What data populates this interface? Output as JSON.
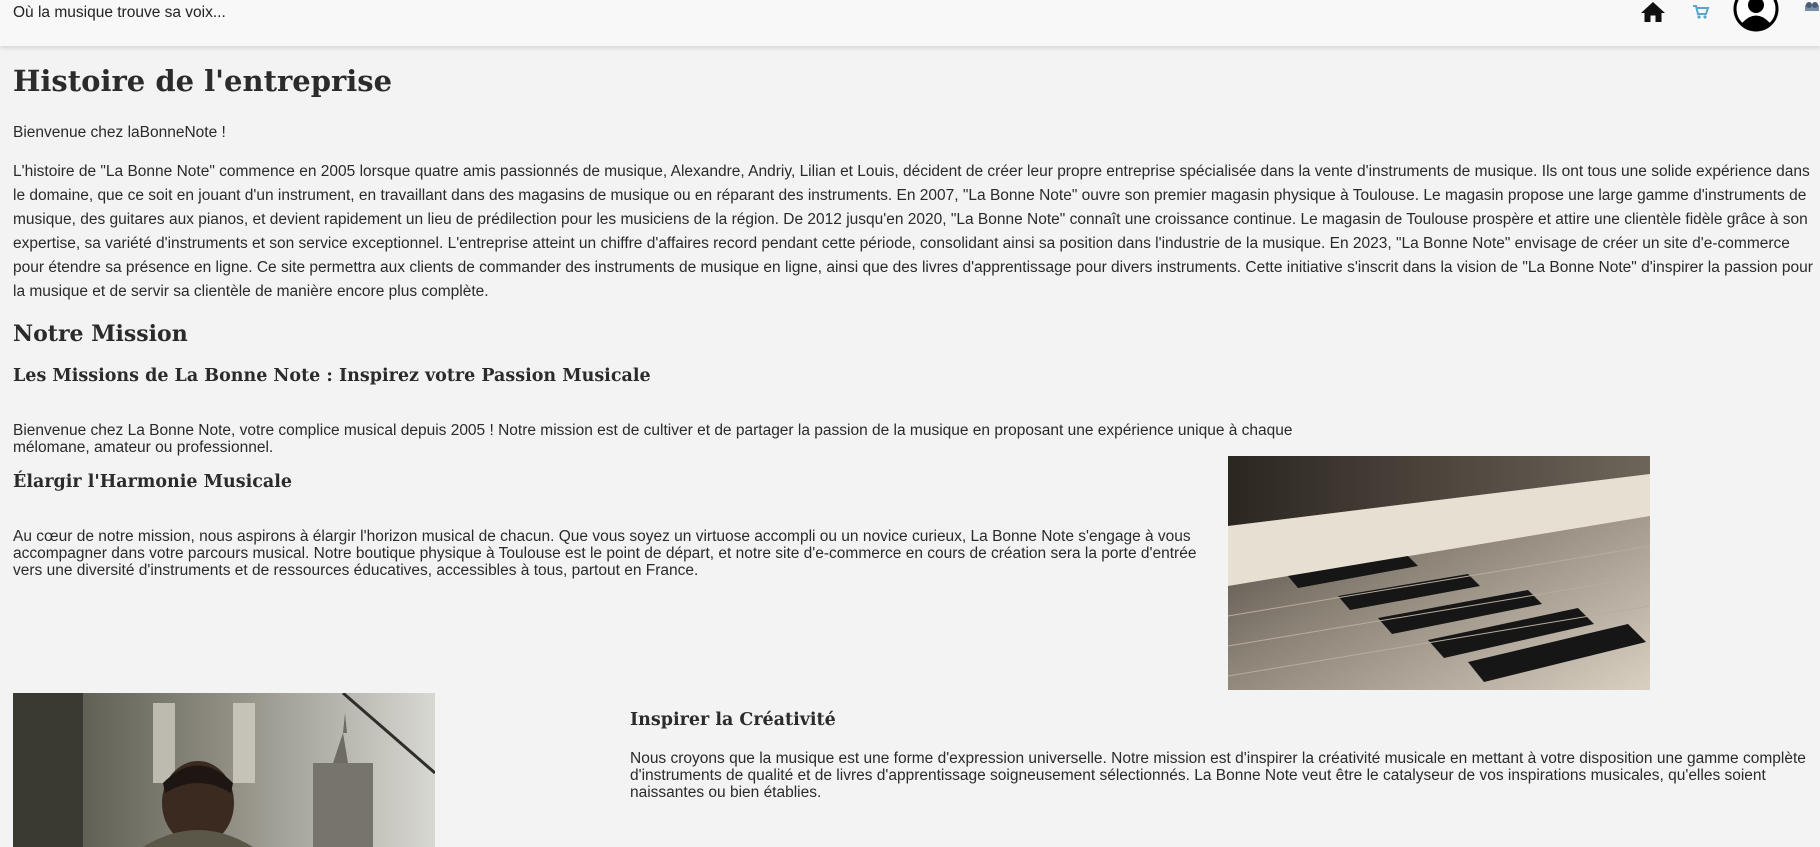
{
  "header": {
    "tagline": "Où la musique trouve sa voix...",
    "icons": [
      "home-icon",
      "cart-icon",
      "user-avatar-icon",
      "misc-icon"
    ],
    "accent_color": "#5aa6c8"
  },
  "history": {
    "title": "Histoire de l'entreprise",
    "welcome": "Bienvenue chez laBonneNote !",
    "body": "L'histoire de \"La Bonne Note\" commence en 2005 lorsque quatre amis passionnés de musique, Alexandre, Andriy, Lilian et Louis, décident de créer leur propre entreprise spécialisée dans la vente d'instruments de musique. Ils ont tous une solide expérience dans le domaine, que ce soit en jouant d'un instrument, en travaillant dans des magasins de musique ou en réparant des instruments. En 2007, \"La Bonne Note\" ouvre son premier magasin physique à Toulouse. Le magasin propose une large gamme d'instruments de musique, des guitares aux pianos, et devient rapidement un lieu de prédilection pour les musiciens de la région. De 2012 jusqu'en 2020, \"La Bonne Note\" connaît une croissance continue. Le magasin de Toulouse prospère et attire une clientèle fidèle grâce à son expertise, sa variété d'instruments et son service exceptionnel. L'entreprise atteint un chiffre d'affaires record pendant cette période, consolidant ainsi sa position dans l'industrie de la musique. En 2023, \"La Bonne Note\" envisage de créer un site d'e-commerce pour étendre sa présence en ligne. Ce site permettra aux clients de commander des instruments de musique en ligne, ainsi que des livres d'apprentissage pour divers instruments. Cette initiative s'inscrit dans la vision de \"La Bonne Note\" d'inspirer la passion pour la musique et de servir sa clientèle de manière encore plus complète."
  },
  "mission": {
    "title": "Notre Mission",
    "subtitle": "Les Missions de La Bonne Note : Inspirez votre Passion Musicale",
    "intro": "Bienvenue chez La Bonne Note, votre complice musical depuis 2005 ! Notre mission est de cultiver et de partager la passion de la musique en proposant une expérience unique à chaque mélomane, amateur ou professionnel.",
    "harmony_title": "Élargir l'Harmonie Musicale",
    "harmony_text": "Au cœur de notre mission, nous aspirons à élargir l'horizon musical de chacun. Que vous soyez un virtuose accompli ou un novice curieux, La Bonne Note s'engage à vous accompagner dans votre parcours musical. Notre boutique physique à Toulouse est le point de départ, et notre site d'e-commerce en cours de création sera la porte d'entrée vers une diversité d'instruments et de ressources éducatives, accessibles à tous, partout en France.",
    "creativity_title": "Inspirer la Créativité",
    "creativity_text": "Nous croyons que la musique est une forme d'expression universelle. Notre mission est d'inspirer la créativité musicale en mettant à votre disposition une gamme complète d'instruments de qualité et de livres d'apprentissage soigneusement sélectionnés. La Bonne Note veut être le catalyseur de vos inspirations musicales, qu'elles soient naissantes ou bien établies."
  }
}
